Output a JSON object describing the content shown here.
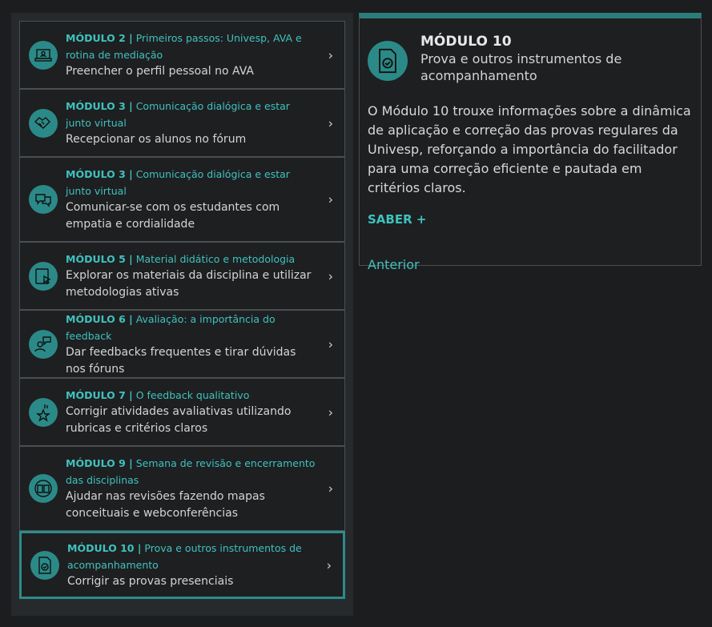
{
  "modules": [
    {
      "num": "MÓDULO 2 |",
      "title": "Primeiros passos: Univesp, AVA e rotina de mediação",
      "desc": "Preencher o perfil pessoal no AVA",
      "icon": "laptop-user-icon"
    },
    {
      "num": "MÓDULO 3 |",
      "title": "Comunicação dialógica e estar junto virtual",
      "desc": "Recepcionar os alunos no fórum",
      "icon": "handshake-icon"
    },
    {
      "num": "MÓDULO 3 |",
      "title": "Comunicação dialógica e estar junto virtual",
      "desc": "Comunicar-se com os estudantes com empatia e cordialidade",
      "icon": "chat-bubbles-icon"
    },
    {
      "num": "MÓDULO 5 |",
      "title": "Material didático e metodologia",
      "desc": "Explorar os materiais da disciplina e utilizar metodologias ativas",
      "icon": "tablet-pointer-icon"
    },
    {
      "num": "MÓDULO 6 |",
      "title": "Avaliação: a importância do feedback",
      "desc": "Dar feedbacks frequentes e tirar dúvidas nos fóruns",
      "icon": "person-speech-icon"
    },
    {
      "num": "MÓDULO 7 |",
      "title": "O feedback qualitativo",
      "desc": "Corrigir atividades avaliativas utilizando rubricas e critérios claros",
      "icon": "hand-star-icon"
    },
    {
      "num": "MÓDULO 9 |",
      "title": "Semana de revisão e encerramento das disciplinas",
      "desc": "Ajudar nas revisões fazendo mapas conceituais e webconferências",
      "icon": "book-cycle-icon"
    },
    {
      "num": "MÓDULO 10 |",
      "title": "Prova e outros instrumentos de acompanhamento",
      "desc": "Corrigir as provas presenciais",
      "icon": "document-check-icon"
    }
  ],
  "detail": {
    "title": "MÓDULO 10",
    "subtitle": "Prova e outros instrumentos de acompanhamento",
    "body": "O Módulo 10 trouxe informações sobre a dinâmica de aplicação e correção das provas regulares da Univesp, reforçando a importância do facilitador para uma correção eficiente e pautada em critérios claros.",
    "more": "SABER +",
    "prev": "Anterior"
  },
  "colors": {
    "accent": "#3fc2be",
    "icon_bg": "#2b8a88",
    "active_border": "#2d8c89"
  }
}
